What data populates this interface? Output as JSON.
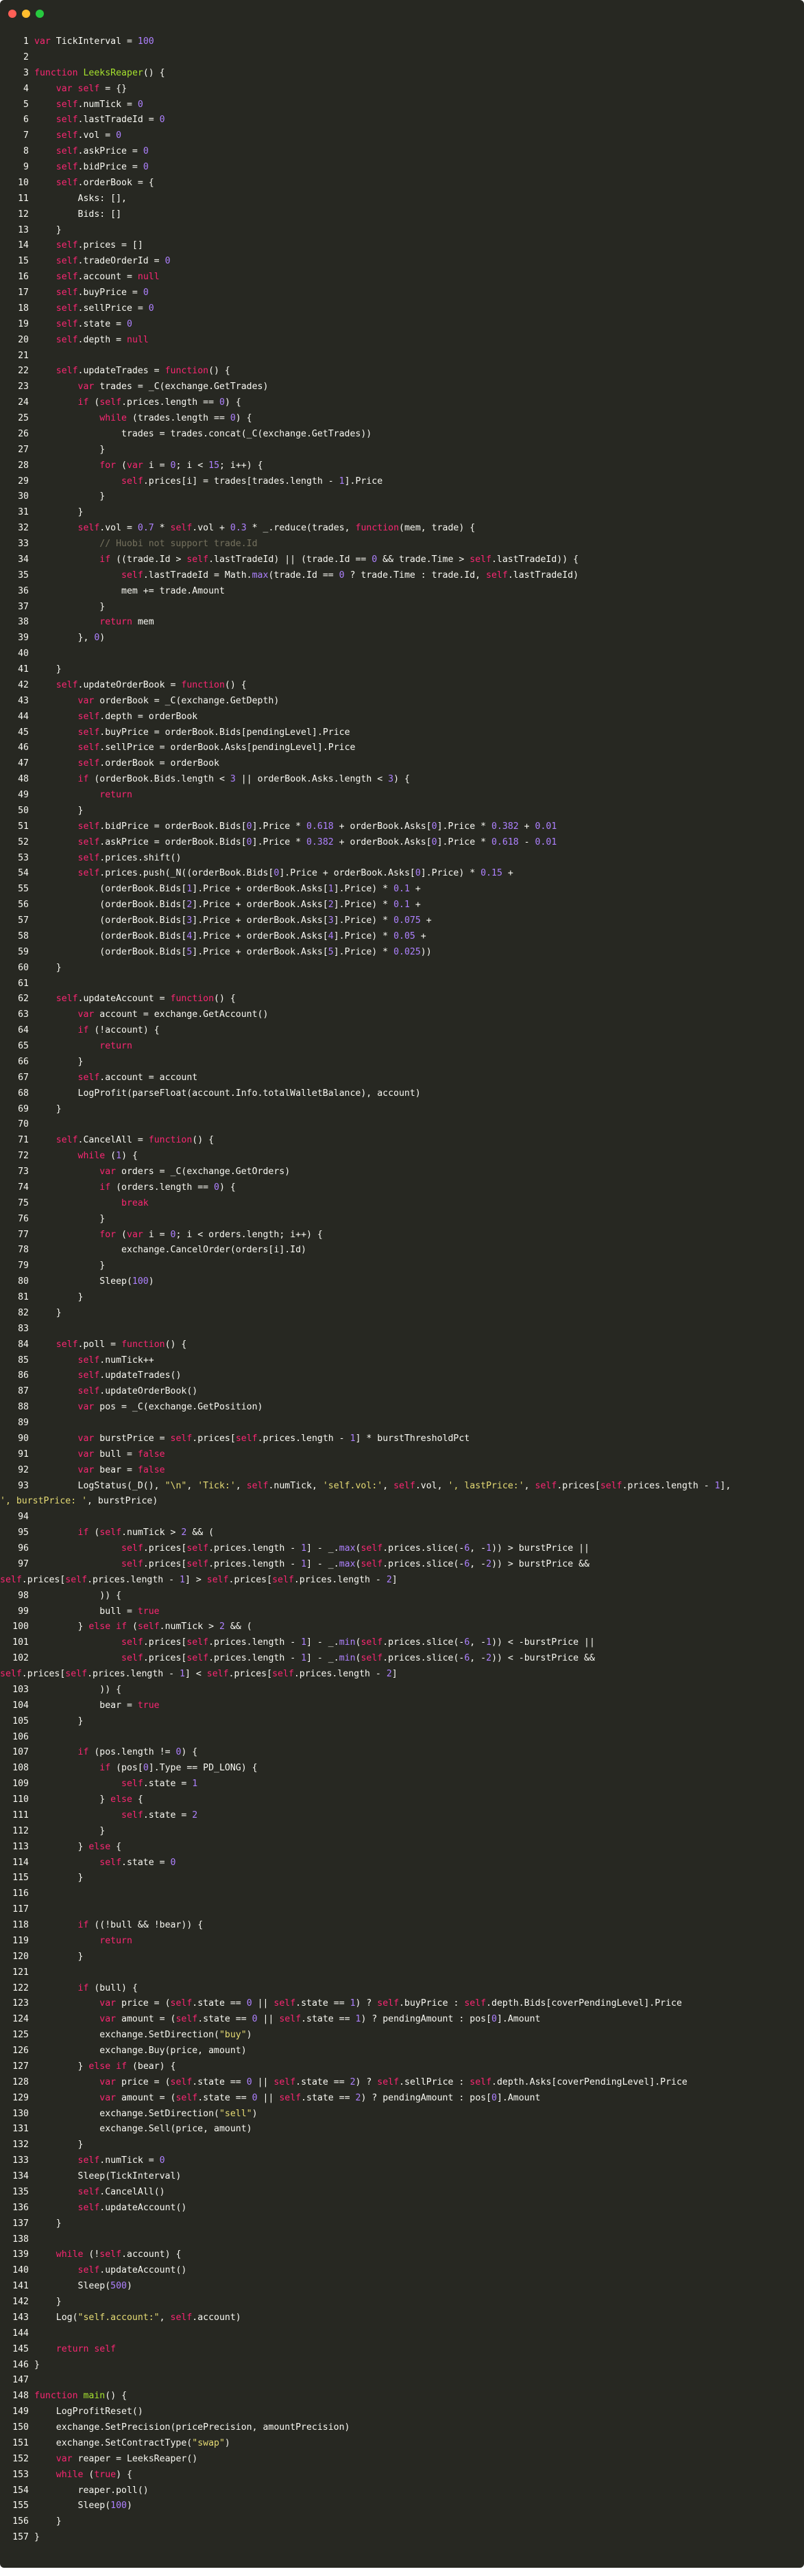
{
  "window": {
    "controls": [
      {
        "name": "close",
        "color": "#ff5f56"
      },
      {
        "name": "minimize",
        "color": "#ffbd2e"
      },
      {
        "name": "zoom",
        "color": "#27c93f"
      }
    ],
    "background": "#272822"
  },
  "theme": {
    "keyword": "#f92672",
    "function": "#a6e22e",
    "number": "#ae81ff",
    "string": "#e6db74",
    "comment": "#75715e",
    "text": "#f8f8f2"
  },
  "code": {
    "lines": [
      "var TickInterval = 100",
      "",
      "function LeeksReaper() {",
      "    var self = {}",
      "    self.numTick = 0",
      "    self.lastTradeId = 0",
      "    self.vol = 0",
      "    self.askPrice = 0",
      "    self.bidPrice = 0",
      "    self.orderBook = {",
      "        Asks: [],",
      "        Bids: []",
      "    }",
      "    self.prices = []",
      "    self.tradeOrderId = 0",
      "    self.account = null",
      "    self.buyPrice = 0",
      "    self.sellPrice = 0",
      "    self.state = 0",
      "    self.depth = null",
      "",
      "    self.updateTrades = function() {",
      "        var trades = _C(exchange.GetTrades)",
      "        if (self.prices.length == 0) {",
      "            while (trades.length == 0) {",
      "                trades = trades.concat(_C(exchange.GetTrades))",
      "            }",
      "            for (var i = 0; i < 15; i++) {",
      "                self.prices[i] = trades[trades.length - 1].Price",
      "            }",
      "        }",
      "        self.vol = 0.7 * self.vol + 0.3 * _.reduce(trades, function(mem, trade) {",
      "            // Huobi not support trade.Id",
      "            if ((trade.Id > self.lastTradeId) || (trade.Id == 0 && trade.Time > self.lastTradeId)) {",
      "                self.lastTradeId = Math.max(trade.Id == 0 ? trade.Time : trade.Id, self.lastTradeId)",
      "                mem += trade.Amount",
      "            }",
      "            return mem",
      "        }, 0)",
      "",
      "    }",
      "    self.updateOrderBook = function() {",
      "        var orderBook = _C(exchange.GetDepth)",
      "        self.depth = orderBook",
      "        self.buyPrice = orderBook.Bids[pendingLevel].Price",
      "        self.sellPrice = orderBook.Asks[pendingLevel].Price",
      "        self.orderBook = orderBook",
      "        if (orderBook.Bids.length < 3 || orderBook.Asks.length < 3) {",
      "            return",
      "        }",
      "        self.bidPrice = orderBook.Bids[0].Price * 0.618 + orderBook.Asks[0].Price * 0.382 + 0.01",
      "        self.askPrice = orderBook.Bids[0].Price * 0.382 + orderBook.Asks[0].Price * 0.618 - 0.01",
      "        self.prices.shift()",
      "        self.prices.push(_N((orderBook.Bids[0].Price + orderBook.Asks[0].Price) * 0.15 +",
      "            (orderBook.Bids[1].Price + orderBook.Asks[1].Price) * 0.1 +",
      "            (orderBook.Bids[2].Price + orderBook.Asks[2].Price) * 0.1 +",
      "            (orderBook.Bids[3].Price + orderBook.Asks[3].Price) * 0.075 +",
      "            (orderBook.Bids[4].Price + orderBook.Asks[4].Price) * 0.05 +",
      "            (orderBook.Bids[5].Price + orderBook.Asks[5].Price) * 0.025))",
      "    }",
      "",
      "    self.updateAccount = function() {",
      "        var account = exchange.GetAccount()",
      "        if (!account) {",
      "            return",
      "        }",
      "        self.account = account",
      "        LogProfit(parseFloat(account.Info.totalWalletBalance), account)",
      "    }",
      "",
      "    self.CancelAll = function() {",
      "        while (1) {",
      "            var orders = _C(exchange.GetOrders)",
      "            if (orders.length == 0) {",
      "                break",
      "            }",
      "            for (var i = 0; i < orders.length; i++) {",
      "                exchange.CancelOrder(orders[i].Id)",
      "            }",
      "            Sleep(100)",
      "        }",
      "    }",
      "",
      "    self.poll = function() {",
      "        self.numTick++",
      "        self.updateTrades()",
      "        self.updateOrderBook()",
      "        var pos = _C(exchange.GetPosition)",
      "",
      "        var burstPrice = self.prices[self.prices.length - 1] * burstThresholdPct",
      "        var bull = false",
      "        var bear = false",
      "        LogStatus(_D(), \"\\n\", 'Tick:', self.numTick, 'self.vol:', self.vol, ', lastPrice:', self.prices[self.prices.length - 1],\n', burstPrice: ', burstPrice)",
      "",
      "        if (self.numTick > 2 && (",
      "                self.prices[self.prices.length - 1] - _.max(self.prices.slice(-6, -1)) > burstPrice ||",
      "                self.prices[self.prices.length - 1] - _.max(self.prices.slice(-6, -2)) > burstPrice &&\nself.prices[self.prices.length - 1] > self.prices[self.prices.length - 2]",
      "            )) {",
      "            bull = true",
      "        } else if (self.numTick > 2 && (",
      "                self.prices[self.prices.length - 1] - _.min(self.prices.slice(-6, -1)) < -burstPrice ||",
      "                self.prices[self.prices.length - 1] - _.min(self.prices.slice(-6, -2)) < -burstPrice &&\nself.prices[self.prices.length - 1] < self.prices[self.prices.length - 2]",
      "            )) {",
      "            bear = true",
      "        }",
      "",
      "        if (pos.length != 0) {",
      "            if (pos[0].Type == PD_LONG) {",
      "                self.state = 1",
      "            } else {",
      "                self.state = 2",
      "            }",
      "        } else {",
      "            self.state = 0",
      "        }",
      "",
      "",
      "        if ((!bull && !bear)) {",
      "            return",
      "        }",
      "",
      "        if (bull) {",
      "            var price = (self.state == 0 || self.state == 1) ? self.buyPrice : self.depth.Bids[coverPendingLevel].Price",
      "            var amount = (self.state == 0 || self.state == 1) ? pendingAmount : pos[0].Amount",
      "            exchange.SetDirection(\"buy\")",
      "            exchange.Buy(price, amount)",
      "        } else if (bear) {",
      "            var price = (self.state == 0 || self.state == 2) ? self.sellPrice : self.depth.Asks[coverPendingLevel].Price",
      "            var amount = (self.state == 0 || self.state == 2) ? pendingAmount : pos[0].Amount",
      "            exchange.SetDirection(\"sell\")",
      "            exchange.Sell(price, amount)",
      "        }",
      "        self.numTick = 0",
      "        Sleep(TickInterval)",
      "        self.CancelAll()",
      "        self.updateAccount()",
      "    }",
      "",
      "    while (!self.account) {",
      "        self.updateAccount()",
      "        Sleep(500)",
      "    }",
      "    Log(\"self.account:\", self.account)",
      "",
      "    return self",
      "}",
      "",
      "function main() {",
      "    LogProfitReset()",
      "    exchange.SetPrecision(pricePrecision, amountPrecision)",
      "    exchange.SetContractType(\"swap\")",
      "    var reaper = LeeksReaper()",
      "    while (true) {",
      "        reaper.poll()",
      "        Sleep(100)",
      "    }",
      "}"
    ]
  }
}
